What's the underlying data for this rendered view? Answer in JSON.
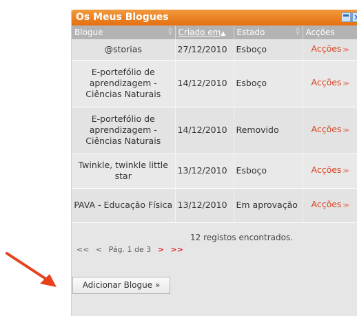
{
  "panel": {
    "title": "Os Meus Blogues"
  },
  "table": {
    "headers": {
      "blog": "Blogue",
      "created": "Criado em",
      "state": "Estado",
      "actions": "Acções"
    },
    "rows": [
      {
        "blog": "@storias",
        "created": "27/12/2010",
        "state": "Esboço",
        "actions": "Acções"
      },
      {
        "blog": "E-portefólio de aprendizagem - Ciências Naturais",
        "created": "14/12/2010",
        "state": "Esboço",
        "actions": "Acções"
      },
      {
        "blog": "E-portefólio de aprendizagem - Ciências Naturais",
        "created": "14/12/2010",
        "state": "Removido",
        "actions": "Acções"
      },
      {
        "blog": "Twinkle, twinkle little star",
        "created": "13/12/2010",
        "state": "Esboço",
        "actions": "Acções"
      },
      {
        "blog": "PAVA - Educação Física",
        "created": "13/12/2010",
        "state": "Em aprovação",
        "actions": "Acções"
      }
    ]
  },
  "pager": {
    "first": "<<",
    "prev": "<",
    "page_text": "Pág. 1 de 3",
    "next": ">",
    "last": ">>",
    "records": "12 registos encontrados."
  },
  "add_button": "Adicionar Blogue »",
  "colors": {
    "titlebar": "#e46f10",
    "arrow": "#e8421c",
    "action": "#d8421e"
  }
}
